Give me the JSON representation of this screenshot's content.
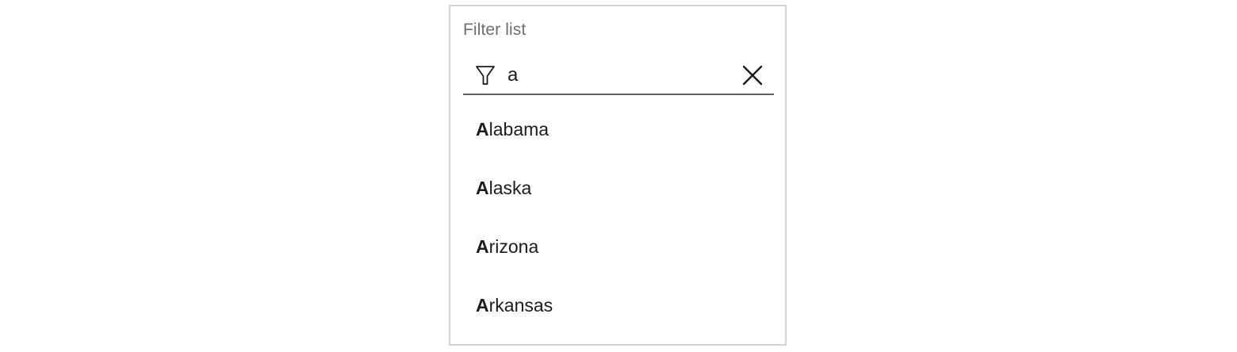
{
  "filter": {
    "label": "Filter list",
    "value": "a",
    "filter_icon": "funnel-icon",
    "clear_icon": "close-icon"
  },
  "results": [
    {
      "match": "A",
      "rest": "labama"
    },
    {
      "match": "A",
      "rest": "laska"
    },
    {
      "match": "A",
      "rest": "rizona"
    },
    {
      "match": "A",
      "rest": "rkansas"
    }
  ],
  "colors": {
    "border": "#d4d4d4",
    "underline": "#5f5f5f",
    "label": "#6e6e6e",
    "text": "#1b1b1b"
  }
}
